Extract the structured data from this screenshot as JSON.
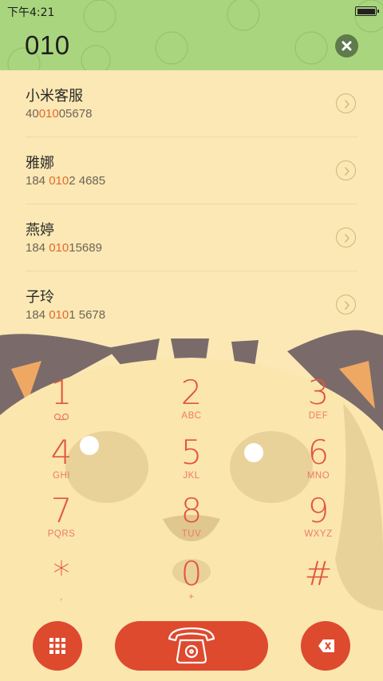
{
  "status_bar": {
    "time": "下午4:21"
  },
  "dialer": {
    "input_value": "010"
  },
  "results": [
    {
      "name": "小米客服",
      "number_pre": "40",
      "number_match": "010",
      "number_post": "05678"
    },
    {
      "name": "雅娜",
      "number_pre": "184 ",
      "number_match": "010",
      "number_post": "2 4685"
    },
    {
      "name": "燕婷",
      "number_pre": "184 ",
      "number_match": "010",
      "number_post": "15689"
    },
    {
      "name": "子玲",
      "number_pre": "184 ",
      "number_match": "010",
      "number_post": "1 5678"
    }
  ],
  "keypad": [
    {
      "digit": "1",
      "letters": ""
    },
    {
      "digit": "2",
      "letters": "ABC"
    },
    {
      "digit": "3",
      "letters": "DEF"
    },
    {
      "digit": "4",
      "letters": "GHI"
    },
    {
      "digit": "5",
      "letters": "JKL"
    },
    {
      "digit": "6",
      "letters": "MNO"
    },
    {
      "digit": "7",
      "letters": "PQRS"
    },
    {
      "digit": "8",
      "letters": "TUV"
    },
    {
      "digit": "9",
      "letters": "WXYZ"
    },
    {
      "digit": "*",
      "letters": ","
    },
    {
      "digit": "0",
      "letters": "+"
    },
    {
      "digit": "#",
      "letters": ""
    }
  ],
  "icons": {
    "clear": "close-icon",
    "voicemail": "voicemail-icon",
    "dialpad": "dialpad-icon",
    "call": "telephone-icon",
    "backspace": "backspace-icon",
    "chevron": "chevron-right-icon"
  },
  "colors": {
    "header_green": "#a9d57e",
    "background": "#fbe8b4",
    "accent_red": "#dd4a2e",
    "highlight_orange": "#e4692e"
  }
}
